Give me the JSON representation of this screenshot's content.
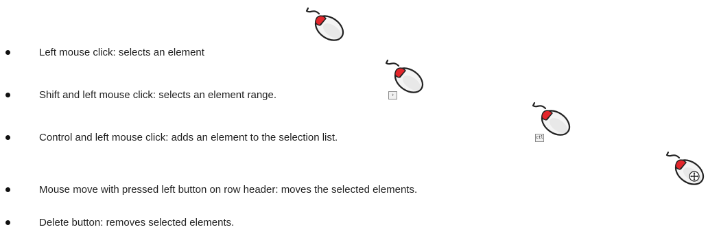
{
  "items": [
    {
      "text": "Left mouse click: selects an element",
      "icon": "mouse-left-click-icon"
    },
    {
      "text": "Shift and left mouse click: selects an element range.",
      "icon": "mouse-shift-click-icon",
      "badge_icon": "shift-key-icon"
    },
    {
      "text": "Control and left mouse click: adds an element to the selection list.",
      "icon": "mouse-ctrl-click-icon",
      "badge_icon": "ctrl-key-icon"
    },
    {
      "text": "Mouse move with pressed left button on row header: moves the selected elements.",
      "icon": "mouse-move-drag-icon"
    },
    {
      "text": "Delete button: removes selected elements."
    }
  ],
  "colors": {
    "mouse_body": "#f4f4f4",
    "mouse_outline": "#222222",
    "mouse_button": "#e3262b"
  }
}
